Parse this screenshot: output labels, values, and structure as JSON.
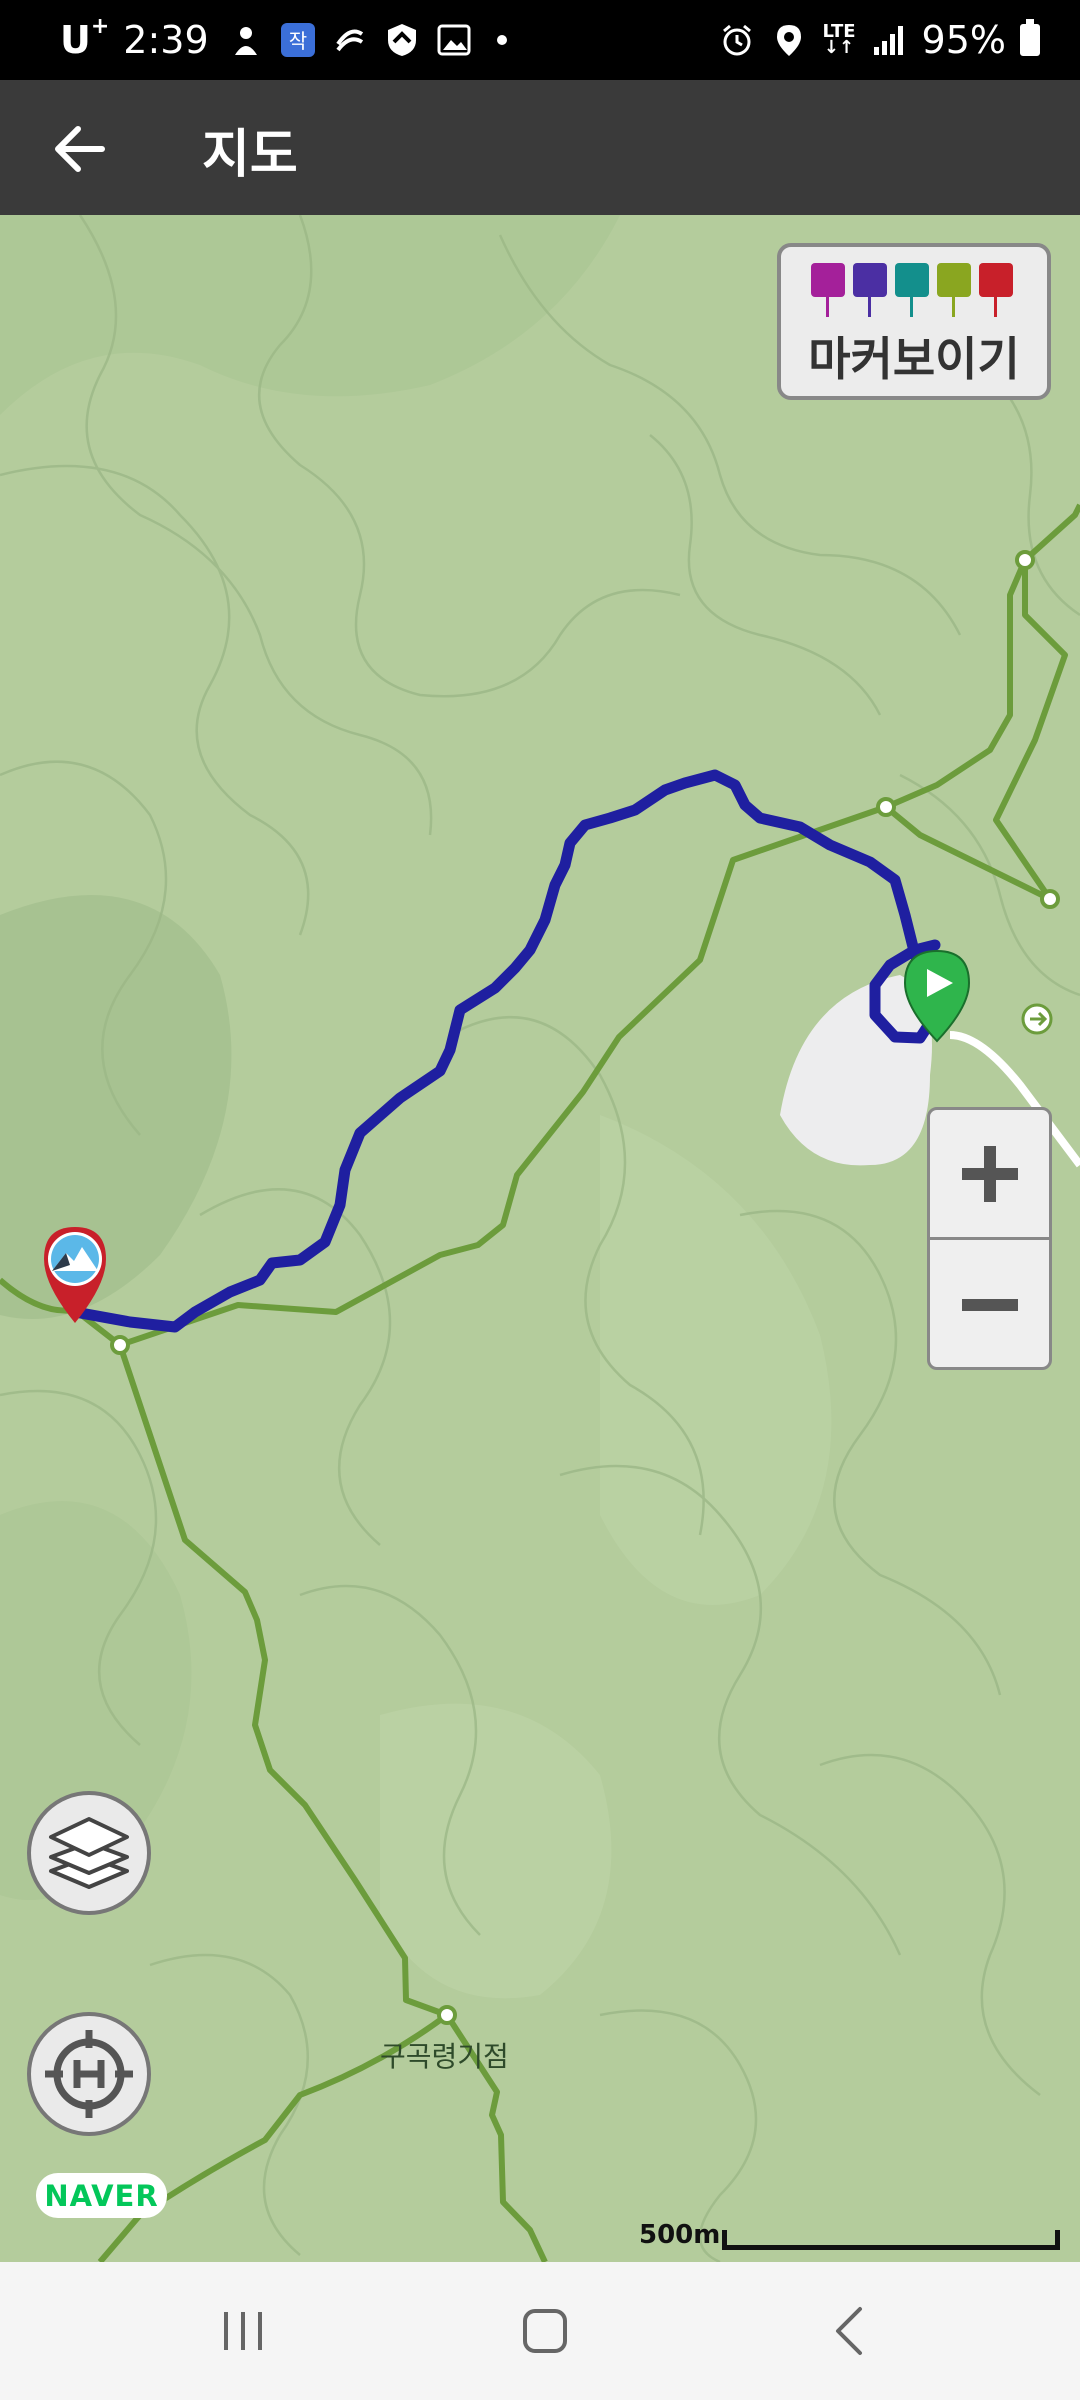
{
  "status_bar": {
    "carrier": "U",
    "carrier_sup": "+",
    "time": "2:39",
    "lte_top": "LTE",
    "lte_bottom": "↓↑",
    "battery": "95%"
  },
  "header": {
    "title": "지도",
    "back_icon": "arrow-left-icon"
  },
  "map": {
    "marker_toggle_label": "마커보이기",
    "marker_icon_colors": [
      "#a4209a",
      "#4b2fa3",
      "#138f8c",
      "#8aa620",
      "#c8202a"
    ],
    "place_label": "구곡령기점",
    "provider": "NAVER",
    "scale": "500m",
    "route_color": "#1f1fa0",
    "trail_color": "#6c9c3c"
  },
  "nav_bar": {
    "recent_icon": "recent-apps-icon",
    "home_icon": "home-icon",
    "back_icon": "back-icon"
  }
}
